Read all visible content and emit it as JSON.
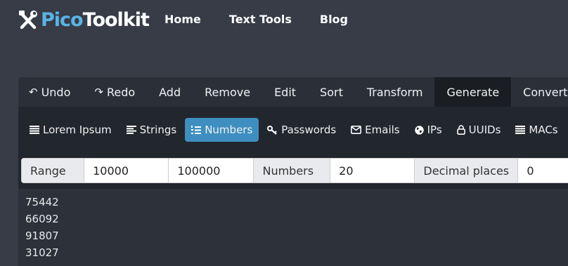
{
  "brand": {
    "part1": "Pico",
    "part2": "Toolkit"
  },
  "nav": {
    "links": [
      "Home",
      "Text Tools",
      "Blog"
    ]
  },
  "menu": {
    "items": [
      {
        "label": "Undo",
        "icon": "undo-icon"
      },
      {
        "label": "Redo",
        "icon": "redo-icon"
      },
      {
        "label": "Add"
      },
      {
        "label": "Remove"
      },
      {
        "label": "Edit"
      },
      {
        "label": "Sort"
      },
      {
        "label": "Transform"
      },
      {
        "label": "Generate",
        "active": true
      },
      {
        "label": "Convert"
      }
    ]
  },
  "subtabs": {
    "items": [
      {
        "label": "Lorem Ipsum",
        "icon": "bars-icon"
      },
      {
        "label": "Strings",
        "icon": "align-left-icon"
      },
      {
        "label": "Numbers",
        "icon": "list-ol-icon",
        "active": true
      },
      {
        "label": "Passwords",
        "icon": "key-icon"
      },
      {
        "label": "Emails",
        "icon": "envelope-icon"
      },
      {
        "label": "IPs",
        "icon": "globe-icon"
      },
      {
        "label": "UUIDs",
        "icon": "lock-icon"
      },
      {
        "label": "MACs",
        "icon": "bars-icon"
      }
    ]
  },
  "form": {
    "range_label": "Range",
    "range_min": "10000",
    "range_max": "100000",
    "numbers_label": "Numbers",
    "numbers_value": "20",
    "decimal_label": "Decimal places",
    "decimal_value": "0"
  },
  "output": {
    "lines": [
      "75442",
      "66092",
      "91807",
      "31027"
    ]
  },
  "colors": {
    "accent": "#3e8fbf",
    "logo_blue": "#5ab4e5",
    "background": "#373c47"
  }
}
